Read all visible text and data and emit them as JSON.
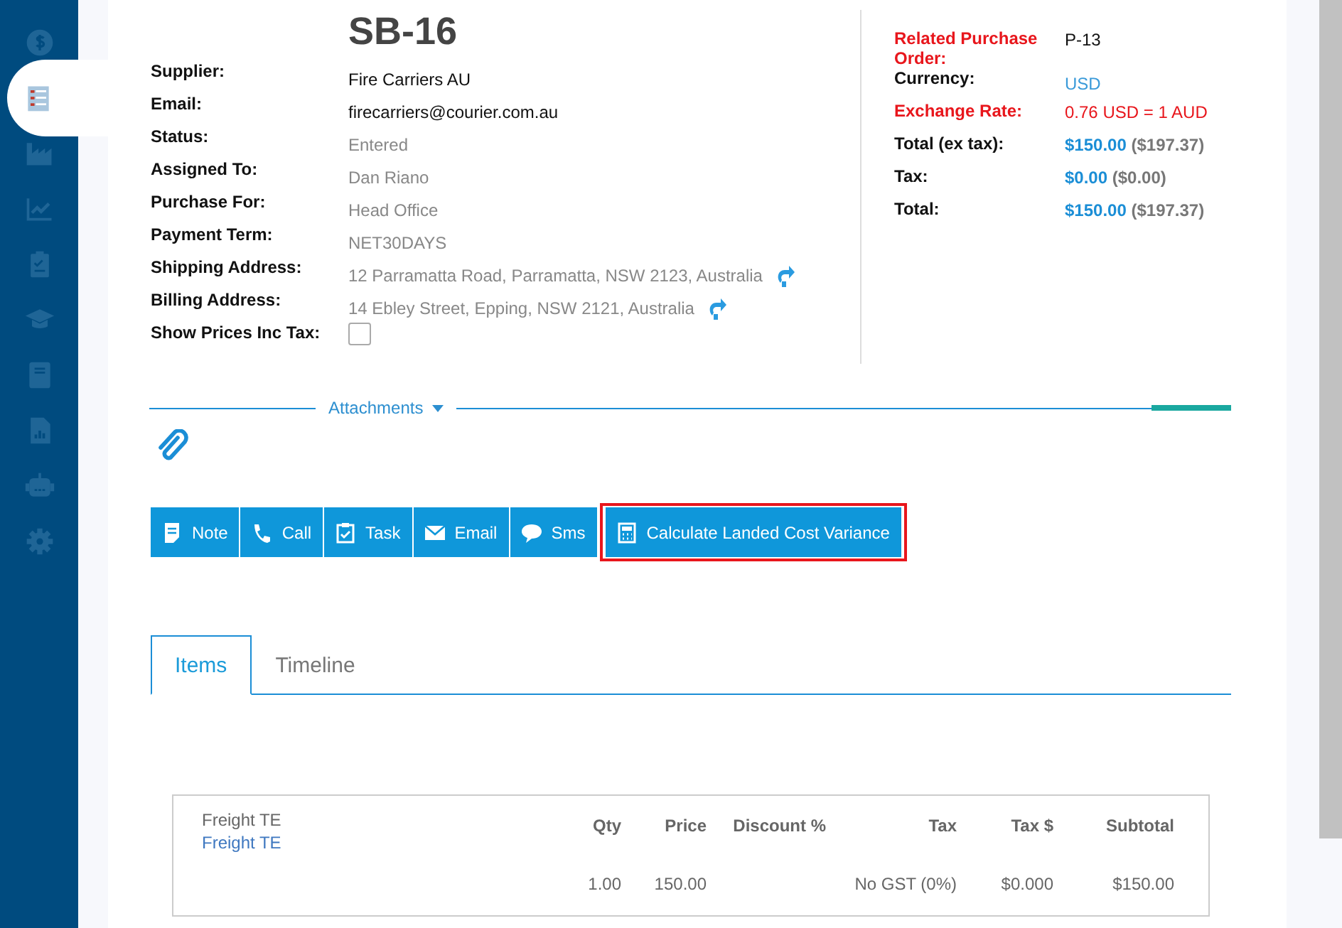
{
  "sidebar": {
    "items": [
      {
        "kind": "dollar",
        "selected": false
      },
      {
        "kind": "checklist",
        "selected": true
      },
      {
        "kind": "factory",
        "selected": false
      },
      {
        "kind": "chart",
        "selected": false
      },
      {
        "kind": "clipboard",
        "selected": false
      },
      {
        "kind": "cap",
        "selected": false
      },
      {
        "kind": "book",
        "selected": false
      },
      {
        "kind": "report",
        "selected": false
      },
      {
        "kind": "robot",
        "selected": false
      },
      {
        "kind": "gear",
        "selected": false
      }
    ]
  },
  "title": "SB-16",
  "details": [
    {
      "label": "Supplier:",
      "kind": "text",
      "value": "Fire Carriers AU"
    },
    {
      "label": "Email:",
      "kind": "text",
      "value": "firecarriers@courier.com.au"
    },
    {
      "label": "Status:",
      "kind": "muted",
      "value": "Entered"
    },
    {
      "label": "Assigned To:",
      "kind": "muted",
      "value": "Dan Riano"
    },
    {
      "label": "Purchase For:",
      "kind": "muted",
      "value": "Head Office"
    },
    {
      "label": "Payment Term:",
      "kind": "muted",
      "value": "NET30DAYS"
    },
    {
      "label": "Shipping Address:",
      "kind": "address",
      "value": "12 Parramatta Road, Parramatta, NSW 2123, Australia"
    },
    {
      "label": "Billing Address:",
      "kind": "address",
      "value": "14 Ebley Street, Epping, NSW 2121, Australia"
    },
    {
      "label": "Show Prices Inc Tax:",
      "kind": "checkbox",
      "checked": false
    }
  ],
  "summary": [
    {
      "label": "Related Purchase Order:",
      "alert": true,
      "kind": "text",
      "value": "P-13"
    },
    {
      "label": "Currency:",
      "alert": false,
      "kind": "link",
      "value": "USD"
    },
    {
      "label": "Exchange Rate:",
      "alert": true,
      "kind": "warning",
      "value": "0.76 USD = 1 AUD"
    },
    {
      "label": "Total (ex tax):",
      "alert": false,
      "kind": "amount",
      "value": "$150.00",
      "converted": "($197.37)"
    },
    {
      "label": "Tax:",
      "alert": false,
      "kind": "amount",
      "value": "$0.00",
      "converted": "($0.00)"
    },
    {
      "label": "Total:",
      "alert": false,
      "kind": "amount",
      "value": "$150.00",
      "converted": "($197.37)"
    }
  ],
  "attachments": {
    "label": "Attachments"
  },
  "actions": [
    {
      "kind": "note",
      "label": "Note",
      "highlighted": false
    },
    {
      "kind": "call",
      "label": "Call",
      "highlighted": false
    },
    {
      "kind": "task",
      "label": "Task",
      "highlighted": false
    },
    {
      "kind": "email",
      "label": "Email",
      "highlighted": false
    },
    {
      "kind": "sms",
      "label": "Sms",
      "highlighted": false
    },
    {
      "kind": "calculator",
      "label": "Calculate Landed Cost Variance",
      "highlighted": true
    }
  ],
  "tabs": [
    {
      "label": "Items",
      "selected": true
    },
    {
      "label": "Timeline",
      "selected": false
    }
  ],
  "table": {
    "columns": [
      "Qty",
      "Price",
      "Discount %",
      "Tax",
      "Tax $",
      "Subtotal"
    ],
    "rows": [
      {
        "item": "Freight TE",
        "description": "Freight TE",
        "cells": [
          "1.00",
          "150.00",
          "",
          "No GST (0%)",
          "$0.000",
          "$150.00"
        ]
      }
    ]
  }
}
